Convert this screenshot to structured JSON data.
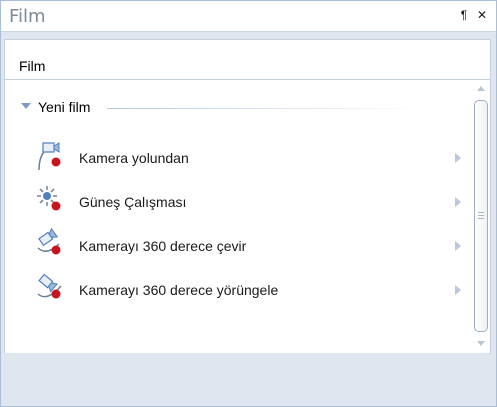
{
  "window": {
    "title": "Film",
    "pin_glyph": "¶",
    "close_glyph": "✕"
  },
  "section": {
    "label": "Film"
  },
  "group": {
    "label": "Yeni film",
    "items": [
      {
        "label": "Kamera yolundan",
        "icon": "camera-path-icon"
      },
      {
        "label": "Güneş Çalışması",
        "icon": "sun-study-icon"
      },
      {
        "label": "Kamerayı 360 derece çevir",
        "icon": "camera-rotate-icon"
      },
      {
        "label": "Kamerayı 360 derece yörüngele",
        "icon": "camera-orbit-icon"
      }
    ]
  },
  "colors": {
    "title_text": "#7d8a98",
    "record_dot": "#c8141c",
    "icon_blue": "#4f7fbf"
  }
}
